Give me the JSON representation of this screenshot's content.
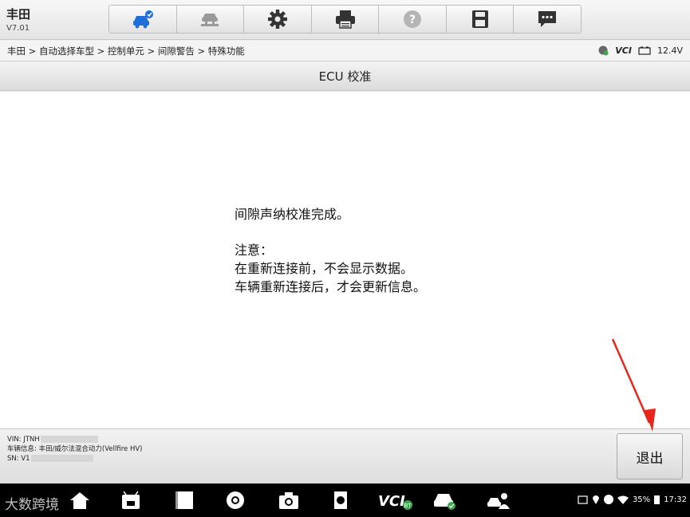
{
  "header": {
    "brand": "丰田",
    "version": "V7.01"
  },
  "toolbar": {
    "icons": [
      "car-home-icon",
      "car-lift-icon",
      "gear-icon",
      "printer-icon",
      "help-icon",
      "save-icon",
      "message-icon"
    ],
    "active_color": "#1e6fd9"
  },
  "breadcrumb": "丰田 > 自动选择车型 > 控制单元 > 间隙警告 > 特殊功能",
  "status": {
    "vci": "VCI",
    "voltage": "12.4V"
  },
  "title": "ECU 校准",
  "message": {
    "line1": "间隙声纳校准完成。",
    "line2": "注意：",
    "line3": "在重新连接前，不会显示数据。",
    "line4": "车辆重新连接后，才会更新信息。"
  },
  "vehicle": {
    "vin_label": "VIN: JTNH",
    "info": "车辆信息: 丰田/威尔法混合动力(Vellfire HV)",
    "sn_label": "SN: V1"
  },
  "exit_label": "退出",
  "nav": {
    "watermark": "大数跨境",
    "battery": "35%",
    "time": "17:32"
  },
  "colors": {
    "arrow": "#e8261c",
    "accent": "#1e6fd9"
  }
}
